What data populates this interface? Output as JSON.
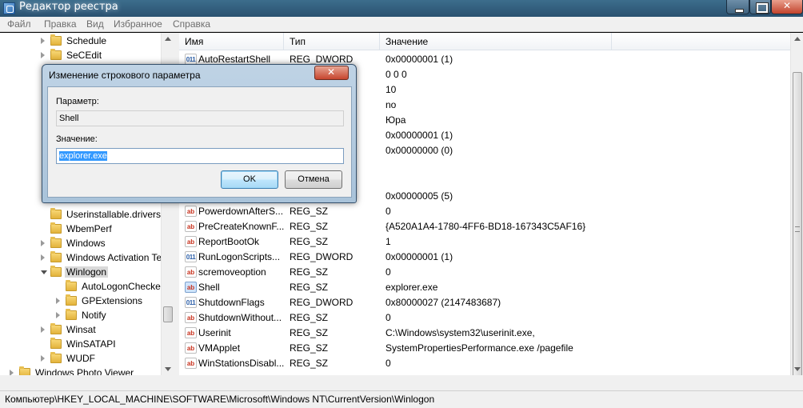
{
  "window": {
    "title": "Редактор реестра"
  },
  "menu": [
    "Файл",
    "Правка",
    "Вид",
    "Избранное",
    "Справка"
  ],
  "tree": {
    "items": [
      {
        "label": "Schedule",
        "indent": 1,
        "expander": "closed"
      },
      {
        "label": "SeCEdit",
        "indent": 1,
        "expander": "closed"
      },
      {
        "label": "Userinstallable.drivers",
        "indent": 1,
        "expander": "none"
      },
      {
        "label": "WbemPerf",
        "indent": 1,
        "expander": "none"
      },
      {
        "label": "Windows",
        "indent": 1,
        "expander": "closed"
      },
      {
        "label": "Windows Activation Te",
        "indent": 1,
        "expander": "closed"
      },
      {
        "label": "Winlogon",
        "indent": 1,
        "expander": "open",
        "selected": true
      },
      {
        "label": "AutoLogonChecke",
        "indent": 2,
        "expander": "none"
      },
      {
        "label": "GPExtensions",
        "indent": 2,
        "expander": "closed"
      },
      {
        "label": "Notify",
        "indent": 2,
        "expander": "closed"
      },
      {
        "label": "Winsat",
        "indent": 1,
        "expander": "closed"
      },
      {
        "label": "WinSATAPI",
        "indent": 1,
        "expander": "none"
      },
      {
        "label": "WUDF",
        "indent": 1,
        "expander": "closed"
      },
      {
        "label": "Windows Photo Viewer",
        "indent": 0,
        "expander": "closed"
      }
    ]
  },
  "values": {
    "headers": {
      "name": "Имя",
      "type": "Тип",
      "data": "Значение"
    },
    "rows": [
      {
        "icon": "reg-dword-icon",
        "name": "AutoRestartShell",
        "type": "REG_DWORD",
        "data": "0x00000001 (1)"
      },
      {
        "icon": "",
        "name": "",
        "type": "",
        "data": "0 0 0"
      },
      {
        "icon": "",
        "name": "",
        "type": "",
        "data": "10"
      },
      {
        "icon": "",
        "name": "",
        "type": "",
        "data": "no"
      },
      {
        "icon": "",
        "name": "",
        "type": "",
        "data": "Юра"
      },
      {
        "icon": "",
        "name": "",
        "type": "",
        "data": "0x00000001 (1)"
      },
      {
        "icon": "",
        "name": "",
        "type": "",
        "data": "0x00000000 (0)"
      },
      {
        "icon": "",
        "name": "",
        "type": "",
        "data": ""
      },
      {
        "icon": "",
        "name": "",
        "type": "",
        "data": ""
      },
      {
        "icon": "",
        "name": "",
        "type": "",
        "data": "0x00000005 (5)"
      },
      {
        "icon": "reg-sz-icon",
        "name": "PowerdownAfterS...",
        "type": "REG_SZ",
        "data": "0"
      },
      {
        "icon": "reg-sz-icon",
        "name": "PreCreateKnownF...",
        "type": "REG_SZ",
        "data": "{A520A1A4-1780-4FF6-BD18-167343C5AF16}"
      },
      {
        "icon": "reg-sz-icon",
        "name": "ReportBootOk",
        "type": "REG_SZ",
        "data": "1"
      },
      {
        "icon": "reg-dword-icon",
        "name": "RunLogonScripts...",
        "type": "REG_DWORD",
        "data": "0x00000001 (1)"
      },
      {
        "icon": "reg-sz-icon",
        "name": "scremoveoption",
        "type": "REG_SZ",
        "data": "0"
      },
      {
        "icon": "reg-sz-icon",
        "name": "Shell",
        "type": "REG_SZ",
        "data": "explorer.exe",
        "highlight": true
      },
      {
        "icon": "reg-dword-icon",
        "name": "ShutdownFlags",
        "type": "REG_DWORD",
        "data": "0x80000027 (2147483687)"
      },
      {
        "icon": "reg-sz-icon",
        "name": "ShutdownWithout...",
        "type": "REG_SZ",
        "data": "0"
      },
      {
        "icon": "reg-sz-icon",
        "name": "Userinit",
        "type": "REG_SZ",
        "data": "C:\\Windows\\system32\\userinit.exe,"
      },
      {
        "icon": "reg-sz-icon",
        "name": "VMApplet",
        "type": "REG_SZ",
        "data": "SystemPropertiesPerformance.exe /pagefile"
      },
      {
        "icon": "reg-sz-icon",
        "name": "WinStationsDisabl...",
        "type": "REG_SZ",
        "data": "0"
      }
    ]
  },
  "status": {
    "path": "Компьютер\\HKEY_LOCAL_MACHINE\\SOFTWARE\\Microsoft\\Windows NT\\CurrentVersion\\Winlogon"
  },
  "dialog": {
    "title": "Изменение строкового параметра",
    "param_label": "Параметр:",
    "param_value": "Shell",
    "value_label": "Значение:",
    "value_value": "explorer.exe",
    "ok_label": "OK",
    "cancel_label": "Отмена"
  },
  "icons": {
    "sz_glyph": "ab",
    "dword_glyph": "011"
  },
  "colors": {
    "titlebar": "#2f5a7a",
    "selection": "#3399ff",
    "close_red": "#c6452e"
  }
}
